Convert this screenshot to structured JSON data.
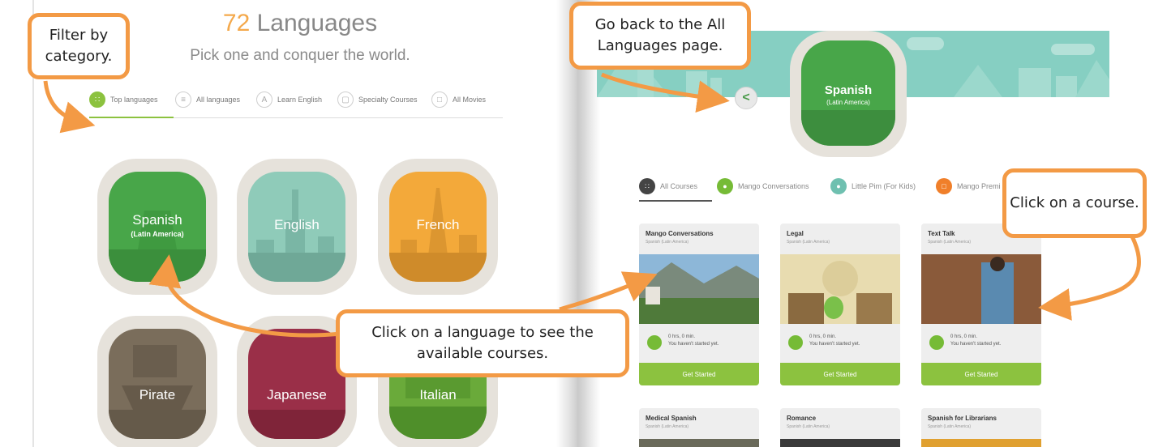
{
  "left": {
    "title_number": "72",
    "title_text": " Languages",
    "subtitle": "Pick one and conquer the world.",
    "tabs": [
      {
        "label": "Top languages",
        "icon": "grid-icon"
      },
      {
        "label": "All languages",
        "icon": "list-icon"
      },
      {
        "label": "Learn English",
        "icon": "letter-a-icon"
      },
      {
        "label": "Specialty Courses",
        "icon": "bookmark-icon"
      },
      {
        "label": "All Movies",
        "icon": "film-icon"
      }
    ],
    "languages": [
      {
        "name": "Spanish",
        "subname": "(Latin America)",
        "color": "#48a649",
        "ground": "#3b8f3c"
      },
      {
        "name": "English",
        "subname": "",
        "color": "#8fcbb9",
        "ground": "#6fa897"
      },
      {
        "name": "French",
        "subname": "",
        "color": "#f3a93a",
        "ground": "#cf8b2a"
      },
      {
        "name": "Pirate",
        "subname": "",
        "color": "#7a6d5b",
        "ground": "#655a4a"
      },
      {
        "name": "Japanese",
        "subname": "",
        "color": "#9a2f48",
        "ground": "#7f2439"
      },
      {
        "name": "Italian",
        "subname": "",
        "color": "#6aaa3a",
        "ground": "#4f8f2a"
      }
    ]
  },
  "right": {
    "hero_name": "Spanish",
    "hero_subname": "(Latin America)",
    "back_symbol": "<",
    "tabs": [
      {
        "label": "All Courses",
        "color": "#444444",
        "icon": "grid-icon"
      },
      {
        "label": "Mango Conversations",
        "color": "#76bb36",
        "icon": "chat-icon"
      },
      {
        "label": "Little Pim (For Kids)",
        "color": "#6fc0b0",
        "icon": "panda-icon"
      },
      {
        "label": "Mango Premi",
        "color": "#f07f2a",
        "icon": "film-icon"
      }
    ],
    "cards": [
      {
        "title": "Mango Conversations",
        "sub": "Spanish (Latin America)",
        "hours": "0 hrs, 0 min.",
        "note": "You haven't started yet.",
        "button": "Get Started"
      },
      {
        "title": "Legal",
        "sub": "Spanish (Latin America)",
        "hours": "0 hrs, 0 min.",
        "note": "You haven't started yet.",
        "button": "Get Started"
      },
      {
        "title": "Text Talk",
        "sub": "Spanish (Latin America)",
        "hours": "0 hrs, 0 min.",
        "note": "You haven't started yet.",
        "button": "Get Started"
      }
    ],
    "cards_row2": [
      {
        "title": "Medical Spanish",
        "sub": "Spanish (Latin America)"
      },
      {
        "title": "Romance",
        "sub": "Spanish (Latin America)"
      },
      {
        "title": "Spanish for Librarians",
        "sub": "Spanish (Latin America)"
      }
    ]
  },
  "callouts": {
    "filter": "Filter by category.",
    "back": "Go back to the All Languages page.",
    "course": "Click on a course.",
    "language": "Click on a language to see the available courses."
  },
  "accent_color": "#f39a45"
}
